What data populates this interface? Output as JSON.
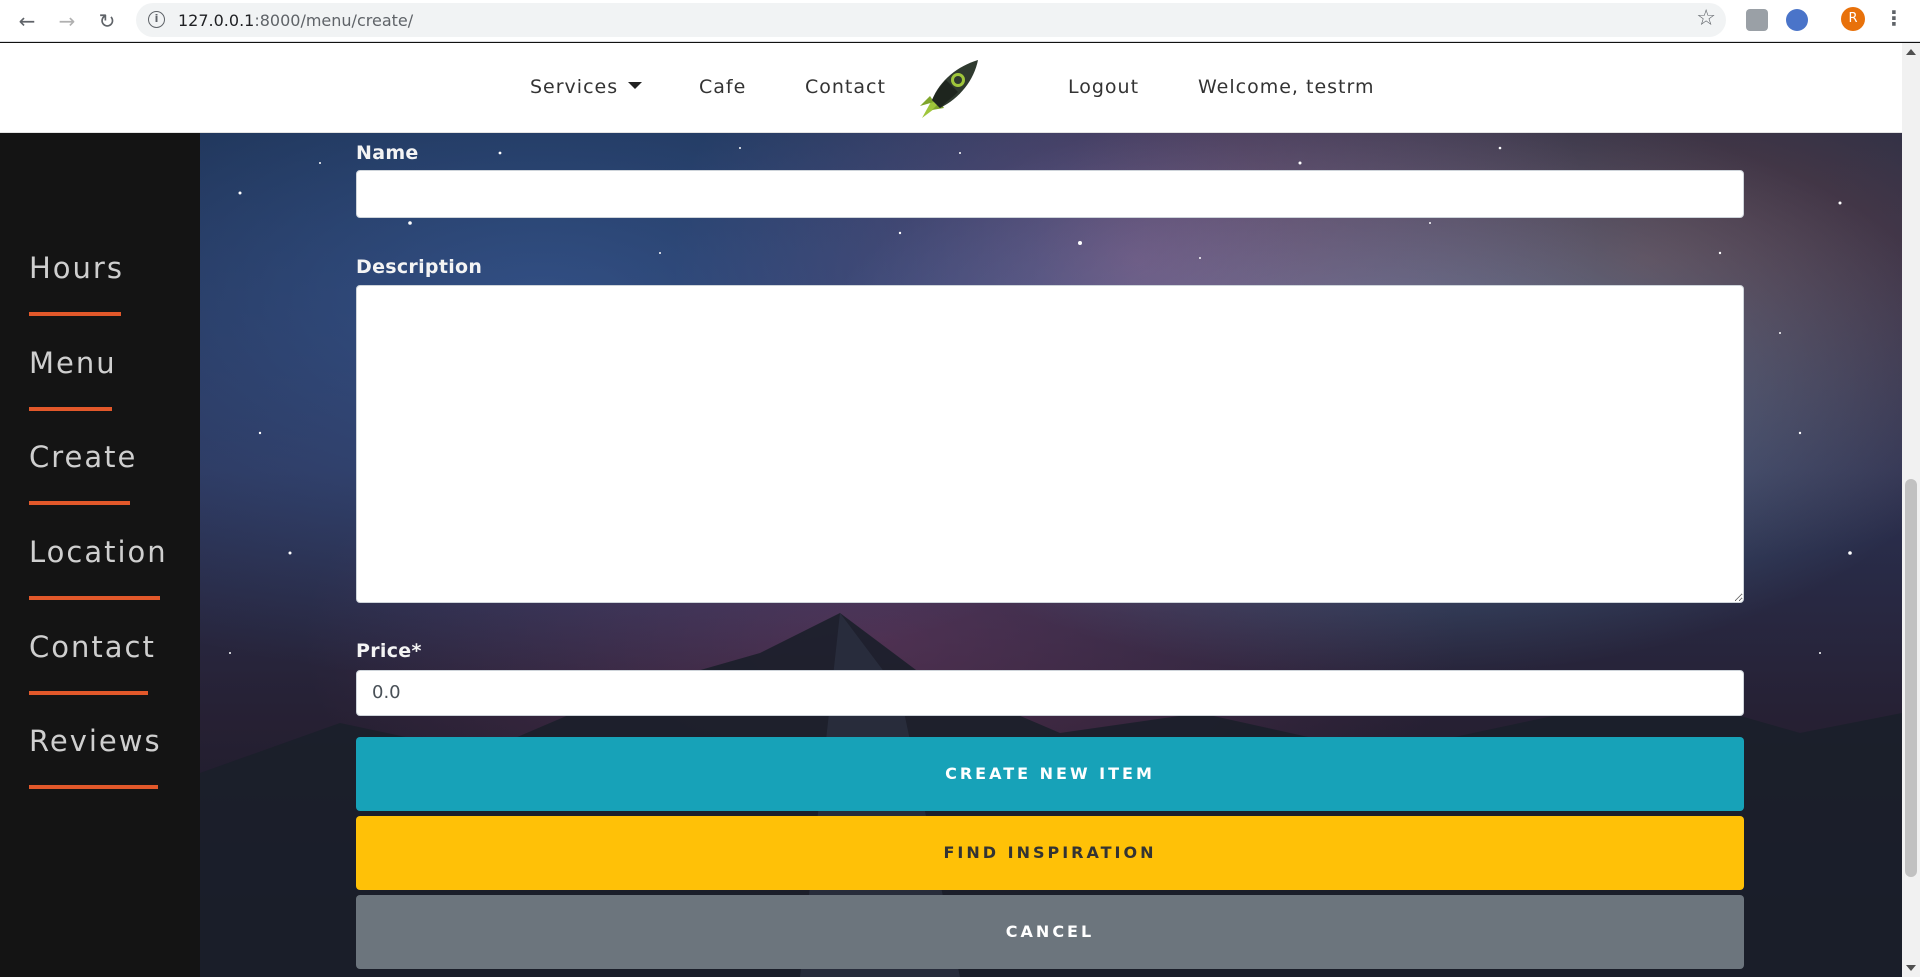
{
  "browser": {
    "url_host": "127.0.0.1",
    "url_rest": ":8000/menu/create/",
    "avatar_letter": "R"
  },
  "nav": {
    "services": "Services",
    "cafe": "Cafe",
    "contact": "Contact",
    "logout": "Logout",
    "welcome": "Welcome, testrm"
  },
  "sidebar": {
    "items": [
      {
        "label": "Hours"
      },
      {
        "label": "Menu"
      },
      {
        "label": "Create"
      },
      {
        "label": "Location"
      },
      {
        "label": "Contact"
      },
      {
        "label": "Reviews"
      }
    ]
  },
  "form": {
    "name_label": "Name",
    "name_value": "",
    "description_label": "Description",
    "description_value": "",
    "price_label": "Price*",
    "price_value": "0.0"
  },
  "buttons": {
    "create": "CREATE NEW ITEM",
    "inspire": "FIND INSPIRATION",
    "cancel": "CANCEL"
  },
  "colors": {
    "accent_line": "#e2582a",
    "create_button": "#17a2b8",
    "inspire_button": "#ffc107",
    "cancel_button": "#6c757d"
  }
}
